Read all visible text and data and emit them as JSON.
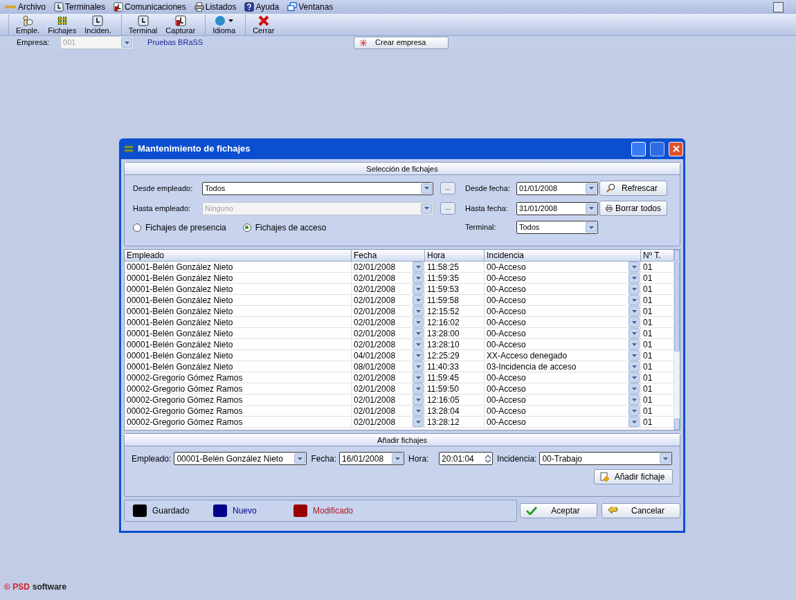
{
  "menu": [
    {
      "label": "Archivo"
    },
    {
      "label": "Terminales"
    },
    {
      "label": "Comunicaciones"
    },
    {
      "label": "Listados"
    },
    {
      "label": "Ayuda"
    },
    {
      "label": "Ventanas"
    }
  ],
  "toolbar": [
    [
      {
        "label": "Emple."
      },
      {
        "label": "Fichajes"
      },
      {
        "label": "Inciden."
      }
    ],
    [
      {
        "label": "Terminal"
      },
      {
        "label": "Capturar"
      }
    ],
    [
      {
        "label": "Idioma"
      }
    ],
    [
      {
        "label": "Cerrar"
      }
    ]
  ],
  "company_bar": {
    "label": "Empresa:",
    "value": "001",
    "disabled": true,
    "name": "Pruebas BRaSS",
    "create_button": "Crear empresa"
  },
  "dialog": {
    "title": "Mantenimiento de fichajes",
    "selection": {
      "title": "Selección de fichajes",
      "from_employee": {
        "label": "Desde empleado:",
        "value": "Todos",
        "disabled": false
      },
      "to_employee": {
        "label": "Hasta empleado:",
        "value": "Ninguno",
        "disabled": true
      },
      "ellipsis": "...",
      "from_date": {
        "label": "Desde fecha:",
        "value": "01/01/2008"
      },
      "to_date": {
        "label": "Hasta fecha:",
        "value": "31/01/2008"
      },
      "terminal": {
        "label": "Terminal:",
        "value": "Todos"
      },
      "radios": [
        {
          "label": "Fichajes de presencia",
          "selected": false
        },
        {
          "label": "Fichajes de acceso",
          "selected": true
        }
      ],
      "buttons": [
        {
          "label": "Refrescar"
        },
        {
          "label": "Borrar todos"
        }
      ]
    },
    "table": {
      "columns": [
        "Empleado",
        "Fecha",
        "Hora",
        "Incidencia",
        "Nº T."
      ],
      "rows": [
        [
          "00001-Belén González Nieto",
          "02/01/2008",
          "11:58:25",
          "00-Acceso",
          "01"
        ],
        [
          "00001-Belén González Nieto",
          "02/01/2008",
          "11:59:35",
          "00-Acceso",
          "01"
        ],
        [
          "00001-Belén González Nieto",
          "02/01/2008",
          "11:59:53",
          "00-Acceso",
          "01"
        ],
        [
          "00001-Belén González Nieto",
          "02/01/2008",
          "11:59:58",
          "00-Acceso",
          "01"
        ],
        [
          "00001-Belén González Nieto",
          "02/01/2008",
          "12:15:52",
          "00-Acceso",
          "01"
        ],
        [
          "00001-Belén González Nieto",
          "02/01/2008",
          "12:16:02",
          "00-Acceso",
          "01"
        ],
        [
          "00001-Belén González Nieto",
          "02/01/2008",
          "13:28:00",
          "00-Acceso",
          "01"
        ],
        [
          "00001-Belén González Nieto",
          "02/01/2008",
          "13:28:10",
          "00-Acceso",
          "01"
        ],
        [
          "00001-Belén González Nieto",
          "04/01/2008",
          "12:25:29",
          "XX-Acceso denegado",
          "01"
        ],
        [
          "00001-Belén González Nieto",
          "08/01/2008",
          "11:40:33",
          "03-Incidencia de acceso",
          "01"
        ],
        [
          "00002-Gregorio Gómez Ramos",
          "02/01/2008",
          "11:59:45",
          "00-Acceso",
          "01"
        ],
        [
          "00002-Gregorio Gómez Ramos",
          "02/01/2008",
          "11:59:50",
          "00-Acceso",
          "01"
        ],
        [
          "00002-Gregorio Gómez Ramos",
          "02/01/2008",
          "12:16:05",
          "00-Acceso",
          "01"
        ],
        [
          "00002-Gregorio Gómez Ramos",
          "02/01/2008",
          "13:28:04",
          "00-Acceso",
          "01"
        ],
        [
          "00002-Gregorio Gómez Ramos",
          "02/01/2008",
          "13:28:12",
          "00-Acceso",
          "01"
        ]
      ]
    },
    "add": {
      "title": "Añadir fichajes",
      "employee": {
        "label": "Empleado:",
        "value": "00001-Belén González Nieto"
      },
      "date": {
        "label": "Fecha:",
        "value": "16/01/2008"
      },
      "time": {
        "label": "Hora:",
        "value": "20:01:04"
      },
      "incidence": {
        "label": "Incidencia:",
        "value": "00-Trabajo"
      },
      "button": "Añadir fichaje"
    },
    "legend": [
      {
        "label": "Guardado",
        "color": "#000000"
      },
      {
        "label": "Nuevo",
        "color": "#00008b"
      },
      {
        "label": "Modificado",
        "color": "#990000"
      }
    ],
    "accept": "Aceptar",
    "cancel": "Cancelar"
  },
  "footer": {
    "brand": "© PSD",
    "word": "software"
  }
}
